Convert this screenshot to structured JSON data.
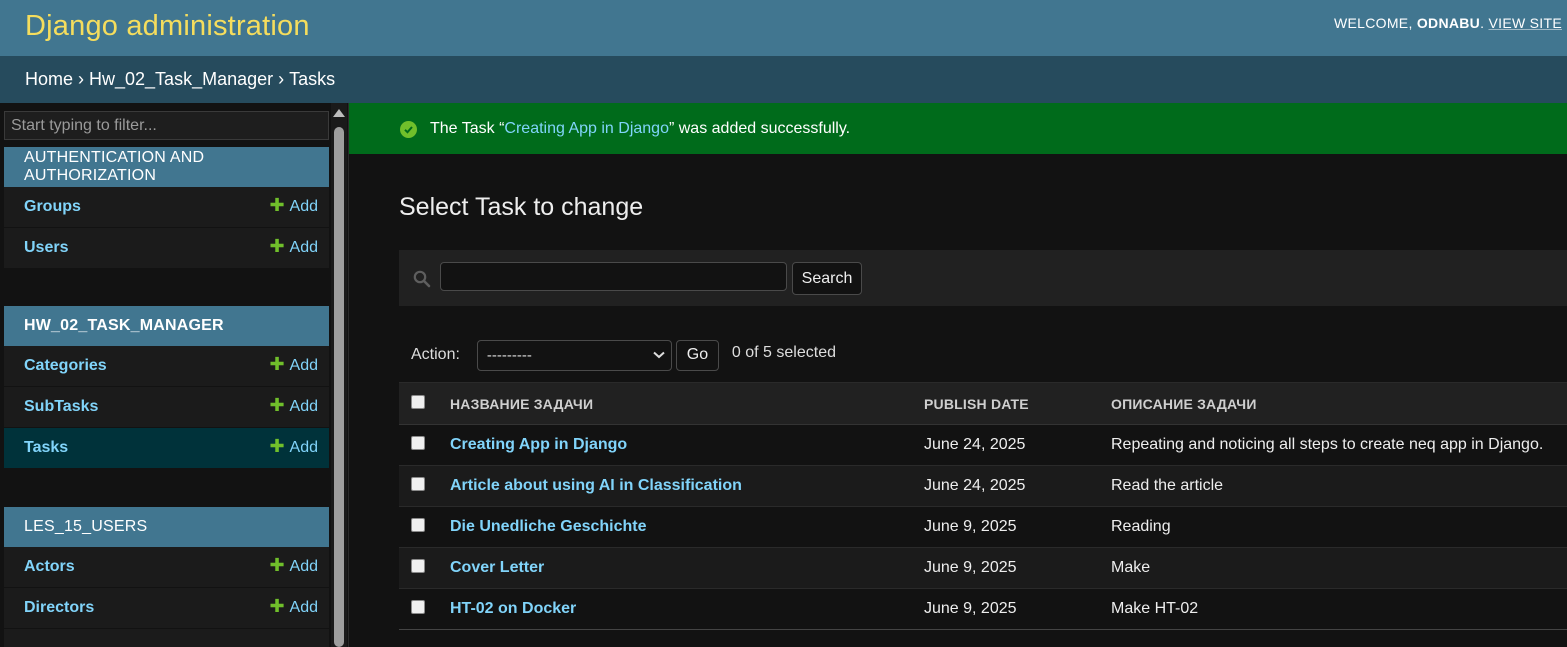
{
  "header": {
    "site_name": "Django administration",
    "welcome": "WELCOME,",
    "username": "ODNABU",
    "view_site": "VIEW SITE"
  },
  "breadcrumbs": {
    "home": "Home",
    "app": "Hw_02_Task_Manager",
    "model": "Tasks",
    "separator": " › "
  },
  "sidebar": {
    "filter_placeholder": "Start typing to filter...",
    "add_label": "Add",
    "modules": [
      {
        "caption": "AUTHENTICATION AND AUTHORIZATION",
        "models": [
          "Groups",
          "Users"
        ]
      },
      {
        "caption": "HW_02_TASK_MANAGER",
        "models": [
          "Categories",
          "SubTasks",
          "Tasks"
        ],
        "current_model": "Tasks"
      },
      {
        "caption": "LES_15_USERS",
        "models": [
          "Actors",
          "Directors"
        ]
      }
    ]
  },
  "message": {
    "prefix": "The Task “",
    "link": "Creating App in Django",
    "suffix": "” was added successfully."
  },
  "content": {
    "title": "Select Task to change",
    "search_button": "Search",
    "search_value": "",
    "action_label": "Action:",
    "action_selected": "---------",
    "go_button": "Go",
    "counter": "0 of 5 selected"
  },
  "table": {
    "columns": [
      "НАЗВАНИЕ ЗАДАЧИ",
      "PUBLISH DATE",
      "ОПИСАНИЕ ЗАДАЧИ"
    ],
    "rows": [
      {
        "name": "Creating App in Django",
        "date": "June 24, 2025",
        "description": "Repeating and noticing all steps to create neq app in Django."
      },
      {
        "name": "Article about using AI in Classification",
        "date": "June 24, 2025",
        "description": "Read the article"
      },
      {
        "name": "Die Unedliche Geschichte",
        "date": "June 9, 2025",
        "description": "Reading"
      },
      {
        "name": "Cover Letter",
        "date": "June 9, 2025",
        "description": "Make"
      },
      {
        "name": "HT-02 on Docker",
        "date": "June 9, 2025",
        "description": "Make HT-02"
      }
    ]
  },
  "colors": {
    "header_bg": "#417690",
    "breadcrumbs_bg": "#264b5d",
    "site_name": "#f5dd5d",
    "link": "#81d4fa",
    "success_bg": "#006b1b",
    "add_plus": "#70bf2b",
    "current_row": "#00323a"
  },
  "icons": {
    "success": "check-circle-icon",
    "search": "magnifier-icon",
    "add": "plus-icon",
    "select": "chevron-down-icon"
  }
}
